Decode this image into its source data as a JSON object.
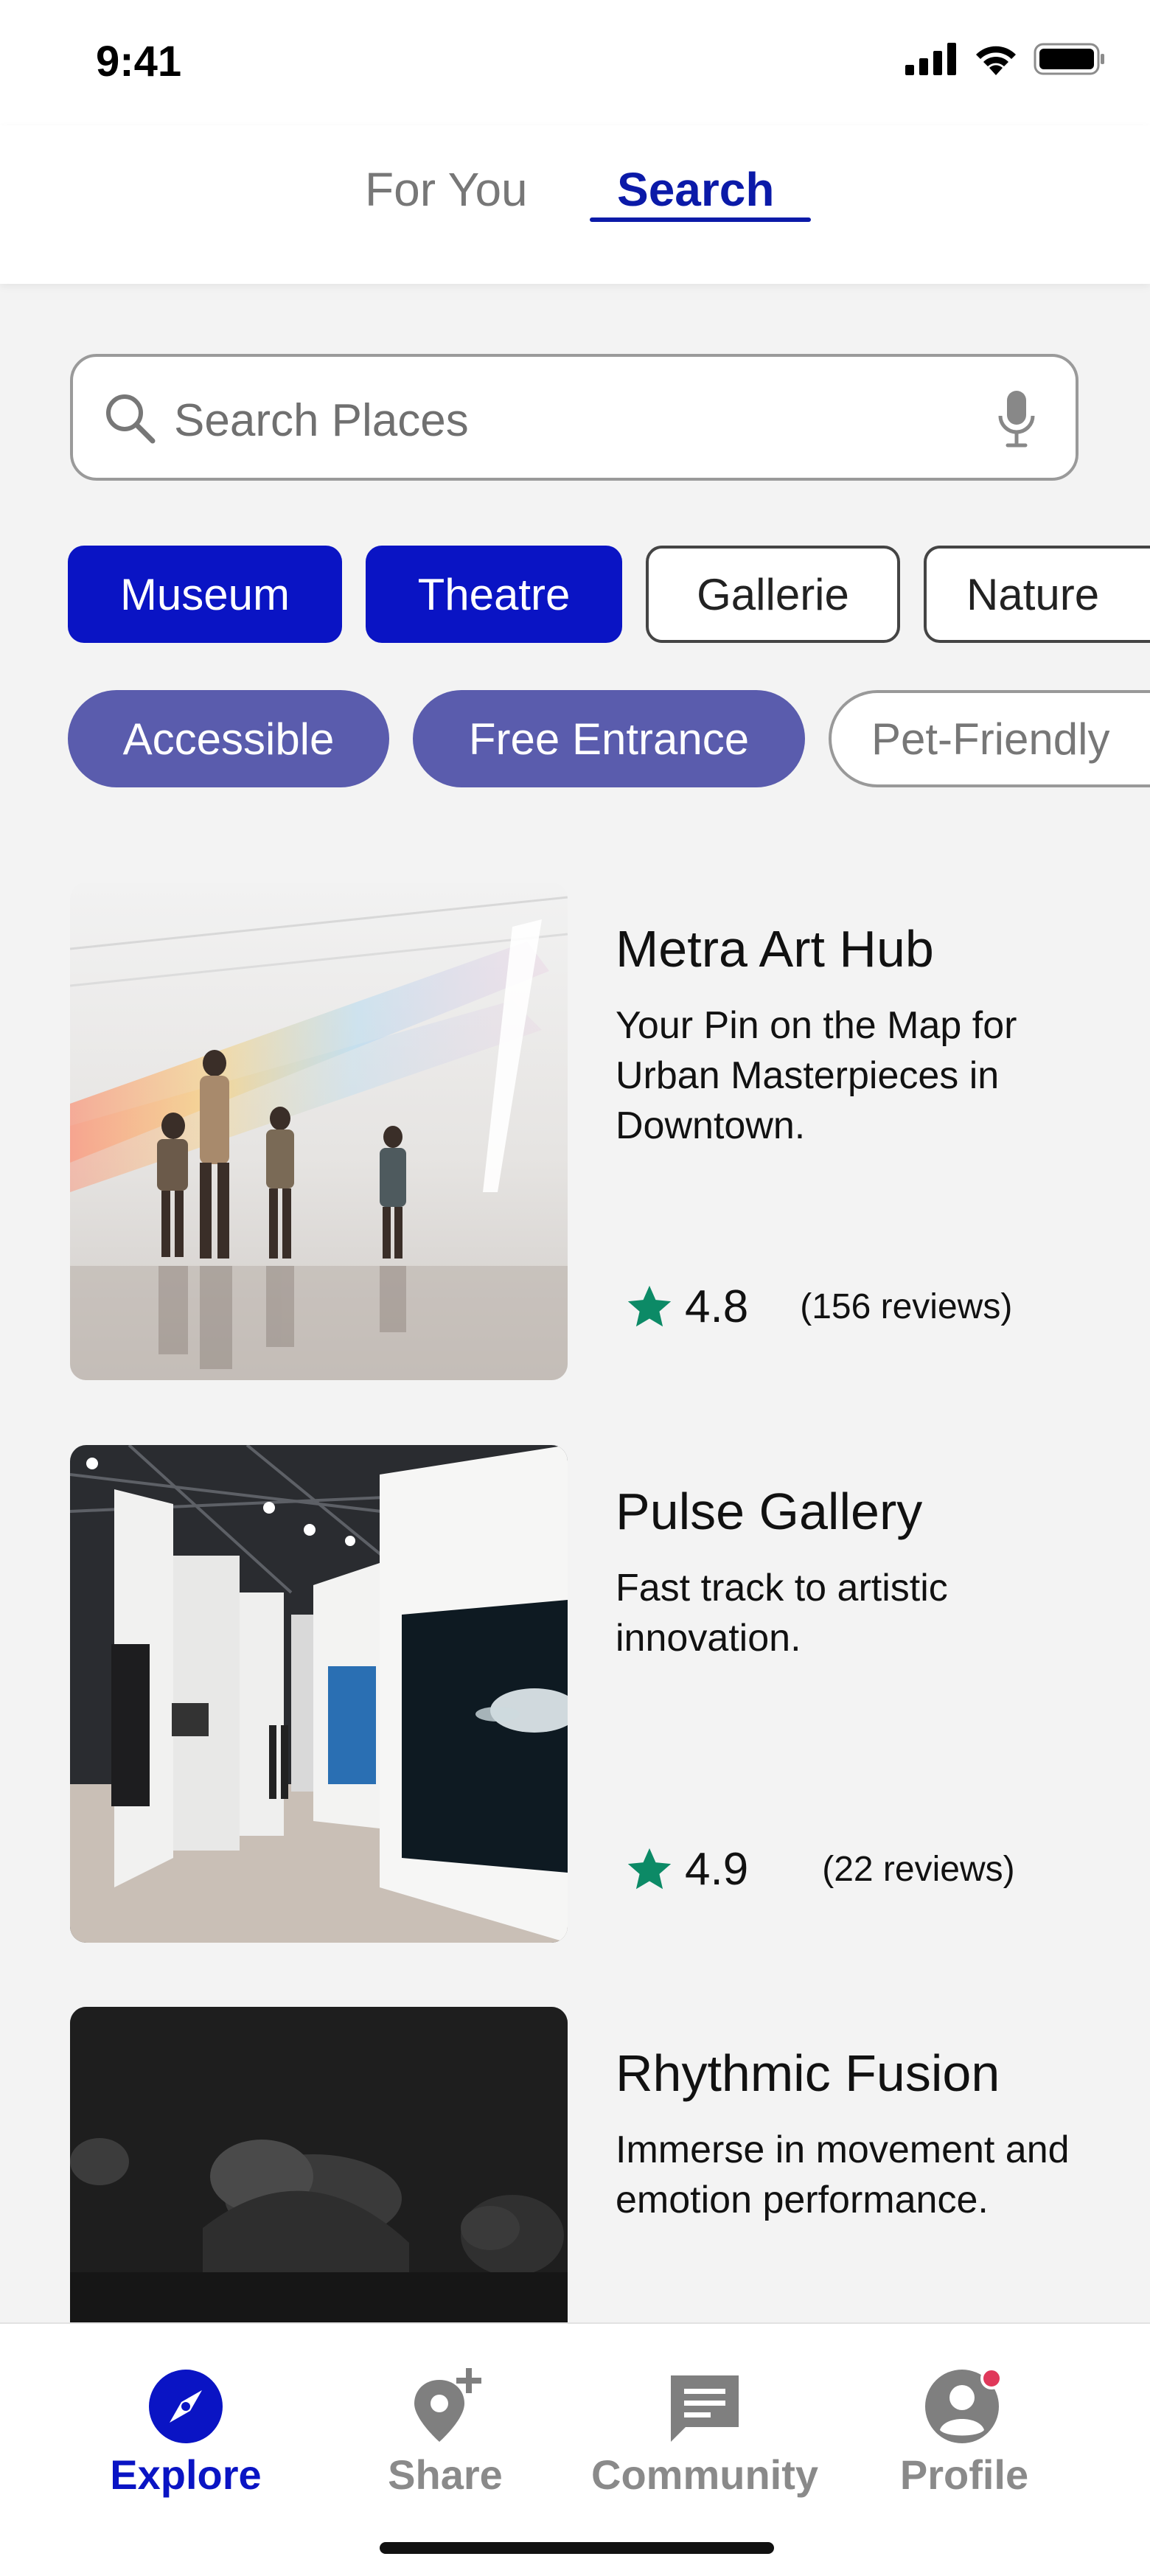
{
  "status_bar": {
    "time": "9:41"
  },
  "tabs": [
    {
      "label": "For You",
      "active": false
    },
    {
      "label": "Search",
      "active": true
    }
  ],
  "search": {
    "placeholder": "Search Places",
    "value": ""
  },
  "categories": [
    {
      "label": "Museum",
      "active": true
    },
    {
      "label": "Theatre",
      "active": true
    },
    {
      "label": "Gallerie",
      "active": false
    },
    {
      "label": "Nature",
      "active": false
    }
  ],
  "filters": [
    {
      "label": "Accessible",
      "active": true
    },
    {
      "label": "Free Entrance",
      "active": true
    },
    {
      "label": "Pet-Friendly",
      "active": false
    }
  ],
  "places": [
    {
      "title": "Metra Art Hub",
      "description": "Your Pin on the Map for Urban Masterpieces in Downtown.",
      "rating": "4.8",
      "reviews": "(156 reviews)"
    },
    {
      "title": "Pulse Gallery",
      "description": "Fast track to artistic innovation.",
      "rating": "4.9",
      "reviews": "(22 reviews)"
    },
    {
      "title": "Rhythmic Fusion",
      "description": "Immerse in movement and emotion performance."
    }
  ],
  "bottom_nav": [
    {
      "label": "Explore",
      "icon": "compass-icon",
      "active": true
    },
    {
      "label": "Share",
      "icon": "location-plus-icon",
      "active": false
    },
    {
      "label": "Community",
      "icon": "chat-icon",
      "active": false
    },
    {
      "label": "Profile",
      "icon": "user-circle-icon",
      "active": false
    }
  ],
  "colors": {
    "primary": "#0a14c4",
    "filter_active": "#5a5cad",
    "star": "#0c8a66",
    "notification": "#e0385a",
    "background": "#f3f3f3"
  }
}
